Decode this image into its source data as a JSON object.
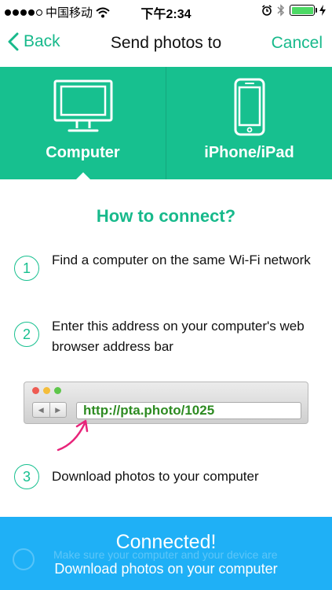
{
  "status_bar": {
    "carrier": "中国移动",
    "time": "下午2:34"
  },
  "nav": {
    "back_label": "Back",
    "title": "Send photos to",
    "cancel_label": "Cancel"
  },
  "segments": [
    {
      "label": "Computer",
      "icon": "monitor-icon",
      "selected": true
    },
    {
      "label": "iPhone/iPad",
      "icon": "phone-icon",
      "selected": false
    }
  ],
  "heading": "How to connect?",
  "steps": [
    {
      "number": "1",
      "text": "Find a computer on the same Wi-Fi network"
    },
    {
      "number": "2",
      "text": "Enter this address on your computer's web browser address bar"
    },
    {
      "number": "3",
      "text": "Download photos to your computer"
    }
  ],
  "browser": {
    "address": "http://pta.photo/1025"
  },
  "banner": {
    "title": "Connected!",
    "subtitle": "Download photos on your computer",
    "faded_text": "Make sure your computer and your device are"
  },
  "colors": {
    "accent": "#17c08f",
    "banner": "#1fb0f6",
    "link_green": "#2e8b22",
    "arrow": "#e8247a"
  }
}
